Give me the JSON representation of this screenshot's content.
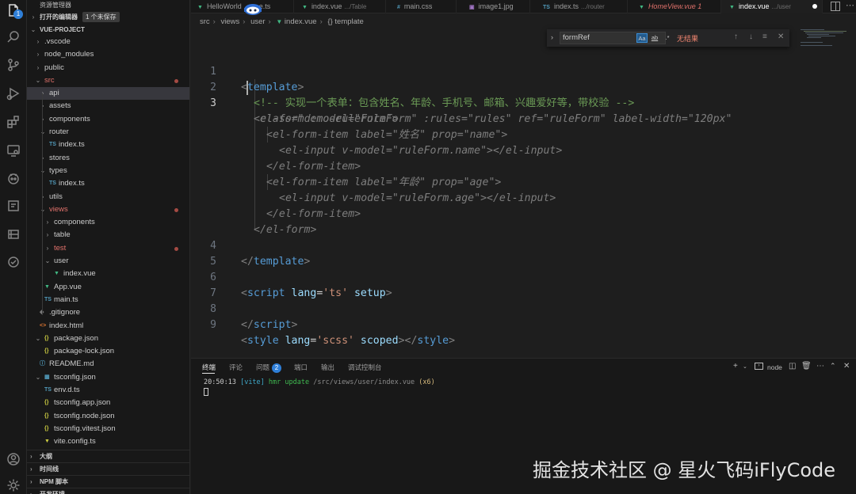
{
  "activity_bar": {
    "explorer_badge": "1",
    "icons": [
      "files-icon",
      "search-icon",
      "source-control-icon",
      "run-debug-icon",
      "extensions-icon",
      "remote-explorer-icon",
      "copilot-icon",
      "docker-icon",
      "database-icon",
      "gitlens-icon",
      "account-icon",
      "settings-gear-icon"
    ]
  },
  "sidebar": {
    "title": "资源管理器",
    "open_editors": {
      "label": "打开的编辑器",
      "unsaved_badge": "1 个未保存"
    },
    "project": "VUE-PROJECT",
    "tree": [
      {
        "label": ".vscode",
        "kind": "folder",
        "depth": 1
      },
      {
        "label": "node_modules",
        "kind": "folder",
        "depth": 1
      },
      {
        "label": "public",
        "kind": "folder",
        "depth": 1
      },
      {
        "label": "src",
        "kind": "folder-open",
        "depth": 1,
        "modified": true
      },
      {
        "label": "api",
        "kind": "folder",
        "depth": 2,
        "selected": true
      },
      {
        "label": "assets",
        "kind": "folder",
        "depth": 2
      },
      {
        "label": "components",
        "kind": "folder",
        "depth": 2
      },
      {
        "label": "router",
        "kind": "folder-open",
        "depth": 2
      },
      {
        "label": "index.ts",
        "kind": "ts",
        "depth": 3
      },
      {
        "label": "stores",
        "kind": "folder",
        "depth": 2
      },
      {
        "label": "types",
        "kind": "folder-open",
        "depth": 2
      },
      {
        "label": "index.ts",
        "kind": "ts",
        "depth": 3
      },
      {
        "label": "utils",
        "kind": "folder",
        "depth": 2
      },
      {
        "label": "views",
        "kind": "folder-open",
        "depth": 2,
        "modified": true
      },
      {
        "label": "components",
        "kind": "folder",
        "depth": 3
      },
      {
        "label": "table",
        "kind": "folder",
        "depth": 3
      },
      {
        "label": "test",
        "kind": "folder",
        "depth": 3,
        "modified": true
      },
      {
        "label": "user",
        "kind": "folder-open",
        "depth": 3
      },
      {
        "label": "index.vue",
        "kind": "vue",
        "depth": 4
      },
      {
        "label": "App.vue",
        "kind": "vue",
        "depth": 2
      },
      {
        "label": "main.ts",
        "kind": "ts",
        "depth": 2
      },
      {
        "label": ".gitignore",
        "kind": "git",
        "depth": 1
      },
      {
        "label": "index.html",
        "kind": "html",
        "depth": 1
      },
      {
        "label": "package.json",
        "kind": "json-open",
        "depth": 1
      },
      {
        "label": "package-lock.json",
        "kind": "json",
        "depth": 2
      },
      {
        "label": "README.md",
        "kind": "info",
        "depth": 1
      },
      {
        "label": "tsconfig.json",
        "kind": "tsconfig-open",
        "depth": 1
      },
      {
        "label": "env.d.ts",
        "kind": "ts",
        "depth": 2
      },
      {
        "label": "tsconfig.app.json",
        "kind": "json",
        "depth": 2
      },
      {
        "label": "tsconfig.node.json",
        "kind": "json",
        "depth": 2
      },
      {
        "label": "tsconfig.vitest.json",
        "kind": "json",
        "depth": 2
      },
      {
        "label": "vite.config.ts",
        "kind": "vite",
        "depth": 2
      }
    ],
    "bottom_sections": [
      "大纲",
      "时间线",
      "NPM 脚本",
      "开发环境"
    ]
  },
  "tabs": [
    {
      "label": "HelloWorld",
      "suffix": "e.ts",
      "icon": "vue"
    },
    {
      "label": "index.vue",
      "path": ".../Table",
      "icon": "vue"
    },
    {
      "label": "main.css",
      "path": "",
      "icon": "css"
    },
    {
      "label": "image1.jpg",
      "path": "",
      "icon": "image"
    },
    {
      "label": "index.ts",
      "path": ".../router",
      "icon": "ts"
    },
    {
      "label": "HomeView.vue 1",
      "path": "",
      "icon": "vue",
      "error": true
    },
    {
      "label": "index.vue",
      "path": ".../user",
      "icon": "vue",
      "active": true
    }
  ],
  "breadcrumb": [
    "src",
    "views",
    "user",
    "index.vue",
    "{} template"
  ],
  "find": {
    "value": "formRef",
    "opt_case": "Aa",
    "opt_word": "ab",
    "opt_regex": ".*",
    "result": "无结果"
  },
  "code_lines": {
    "n1": "1",
    "n2": "2",
    "n3": "3",
    "n4": "4",
    "n5": "5",
    "n6": "6",
    "n7": "7",
    "n8": "8",
    "n9": "9",
    "comment": "<!-- 实现一个表单：包含姓名、年龄、手机号、邮箱、兴趣爱好等，带校验 -->",
    "form_open_1": "el-form :model=\"ruleForm\" :rules=\"rules\" ref=\"ruleForm\" label-width=\"120px\"",
    "form_open_2": "class=\"demo-ruleForm\">",
    "item1_open": "<el-form-item label=\"姓名\" prop=\"name\">",
    "input1": "<el-input v-model=\"ruleForm.name\"></el-input>",
    "item_close": "</el-form-item>",
    "item2_open": "<el-form-item label=\"年龄\" prop=\"age\">",
    "input2": "<el-input v-model=\"ruleForm.age\"></el-input>",
    "form_close": "</el-form>",
    "script_lang": "'ts'",
    "style_lang": "'scss'"
  },
  "panel": {
    "tabs": [
      "终端",
      "评论",
      "问题",
      "端口",
      "输出",
      "调试控制台"
    ],
    "problems_count": "2",
    "terminal_name": "node",
    "terminal": {
      "time": "20:50:13",
      "tag": "[vite]",
      "msg": "hmr update",
      "path": "/src/views/user/index.vue",
      "count": "(x6)"
    }
  },
  "watermark": "掘金技术社区 @ 星火飞码iFlyCode"
}
